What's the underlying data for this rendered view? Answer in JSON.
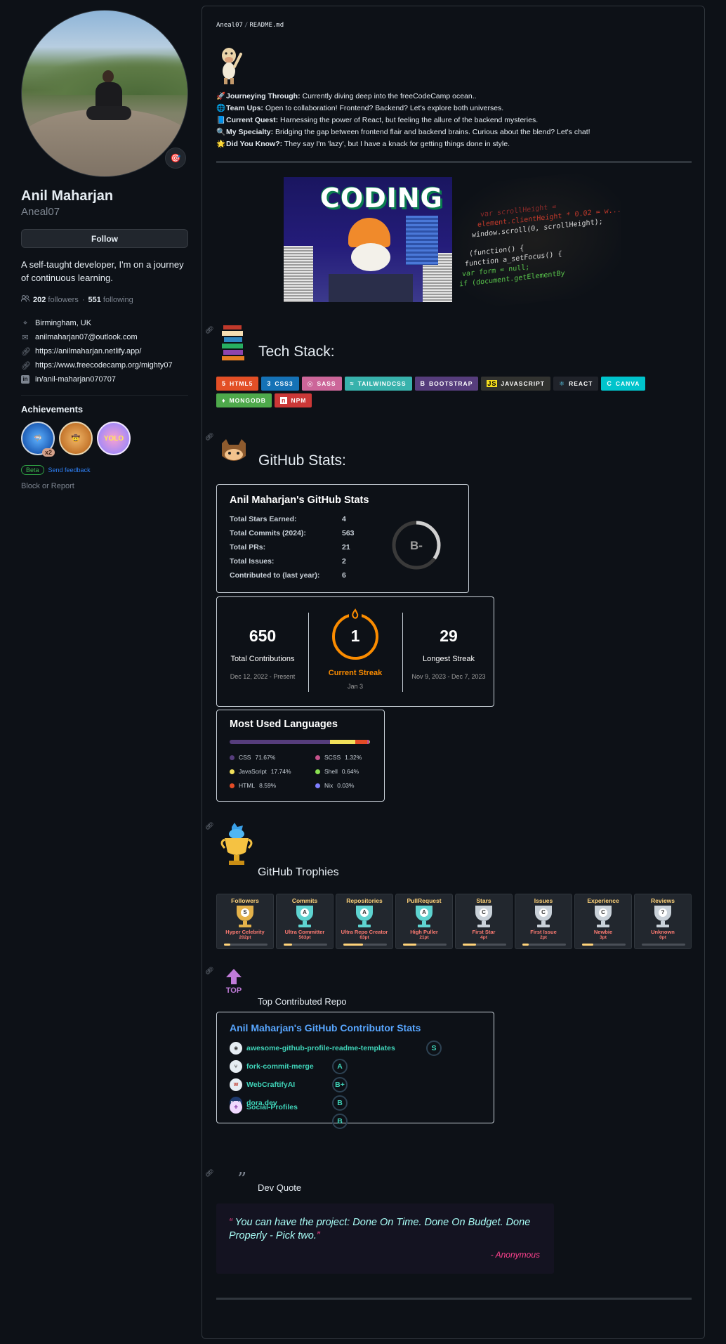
{
  "profile": {
    "full_name": "Anil Maharjan",
    "username": "Aneal07",
    "follow_label": "Follow",
    "bio": "A self-taught developer, I'm on a journey of continuous learning.",
    "followers_count": "202",
    "followers_label": "followers",
    "following_count": "551",
    "following_label": "following",
    "separator": "·",
    "location": "Birmingham, UK",
    "email": "anilmaharjan07@outlook.com",
    "website": "https://anilmaharjan.netlify.app/",
    "website2": "https://www.freecodecamp.org/mighty07",
    "linkedin": "in/anil-maharjan070707",
    "achievements_title": "Achievements",
    "badge_multiplier": "x2",
    "beta_label": "Beta",
    "send_feedback": "Send feedback",
    "block_report": "Block or Report"
  },
  "readme": {
    "repo": "Aneal07",
    "sep": "/",
    "file": "README.md",
    "intro": [
      {
        "emoji": "🚀",
        "label": "Journeying Through:",
        "text": "Currently diving deep into the freeCodeCamp ocean.."
      },
      {
        "emoji": "🌐",
        "label": "Team Ups:",
        "text": "Open to collaboration! Frontend? Backend? Let's explore both universes."
      },
      {
        "emoji": "📘",
        "label": "Current Quest:",
        "text": "Harnessing the power of React, but feeling the allure of the backend mysteries."
      },
      {
        "emoji": "🔍",
        "label": "My Specialty:",
        "text": "Bridging the gap between frontend flair and backend brains. Curious about the blend? Let's chat!"
      },
      {
        "emoji": "🌟",
        "label": "Did You Know?:",
        "text": "They say I'm 'lazy', but I have a knack for getting things done in style."
      }
    ],
    "coding_gif_text": "CODING",
    "code_lines": [
      "var scrollHeight =",
      "element.clientHeight * 0.02 = w...",
      "window.scroll(0, scrollHeight);",
      "(function() {",
      "function a_setFocus() {",
      "var form = null;",
      "if (document.getElementBy"
    ],
    "tech_stack_title": "Tech Stack:",
    "shields": [
      {
        "label": "HTML5",
        "bg": "#e34f26",
        "icon": "5"
      },
      {
        "label": "CSS3",
        "bg": "#1572b6",
        "icon": "3"
      },
      {
        "label": "SASS",
        "bg": "#cc6699",
        "icon": "◎"
      },
      {
        "label": "TAILWINDCSS",
        "bg": "#38b2ac",
        "icon": "≈"
      },
      {
        "label": "BOOTSTRAP",
        "bg": "#563d7c",
        "icon": "B"
      },
      {
        "label": "JAVASCRIPT",
        "bg": "#323330",
        "icon": "JS"
      },
      {
        "label": "REACT",
        "bg": "#20232a",
        "icon": "⚛"
      },
      {
        "label": "CANVA",
        "bg": "#00c4cc",
        "icon": "C"
      },
      {
        "label": "MONGODB",
        "bg": "#4ea94b",
        "icon": "♦"
      },
      {
        "label": "NPM",
        "bg": "#cb3837",
        "icon": "n"
      }
    ],
    "github_stats_title": "GitHub Stats:",
    "stats_card": {
      "title": "Anil Maharjan's GitHub Stats",
      "rows": [
        {
          "label": "Total Stars Earned:",
          "value": "4"
        },
        {
          "label": "Total Commits (2024):",
          "value": "563"
        },
        {
          "label": "Total PRs:",
          "value": "21"
        },
        {
          "label": "Total Issues:",
          "value": "2"
        },
        {
          "label": "Contributed to (last year):",
          "value": "6"
        }
      ],
      "grade": "B-",
      "grade_progress": 0.35
    },
    "streak": {
      "total": "650",
      "total_label": "Total Contributions",
      "total_range": "Dec 12, 2022 - Present",
      "current": "1",
      "current_label": "Current Streak",
      "current_date": "Jan 3",
      "longest": "29",
      "longest_label": "Longest Streak",
      "longest_range": "Nov 9, 2023 - Dec 7, 2023"
    },
    "languages": {
      "title": "Most Used Languages",
      "items": [
        {
          "name": "CSS",
          "pct": "71.67%",
          "value": 71.67,
          "color": "#563d7c"
        },
        {
          "name": "JavaScript",
          "pct": "17.74%",
          "value": 17.74,
          "color": "#f1e05a"
        },
        {
          "name": "HTML",
          "pct": "8.59%",
          "value": 8.59,
          "color": "#e34c26"
        },
        {
          "name": "SCSS",
          "pct": "1.32%",
          "value": 1.32,
          "color": "#c6538c"
        },
        {
          "name": "Shell",
          "pct": "0.64%",
          "value": 0.64,
          "color": "#89e051"
        },
        {
          "name": "Nix",
          "pct": "0.03%",
          "value": 0.03,
          "color": "#7e7eff"
        }
      ]
    },
    "trophies_title": "GitHub Trophies",
    "trophies": [
      {
        "title": "Followers",
        "rank": "S",
        "name": "Hyper Celebrity",
        "points": "202pt",
        "progress": 0.15,
        "color": "#e4b24a"
      },
      {
        "title": "Commits",
        "rank": "A",
        "name": "Ultra Committer",
        "points": "563pt",
        "progress": 0.2,
        "color": "#5ed3d0"
      },
      {
        "title": "Repositories",
        "rank": "A",
        "name": "Ultra Repo Creator",
        "points": "63pt",
        "progress": 0.45,
        "color": "#5ed3d0"
      },
      {
        "title": "PullRequest",
        "rank": "A",
        "name": "High Puller",
        "points": "21pt",
        "progress": 0.3,
        "color": "#5ed3d0"
      },
      {
        "title": "Stars",
        "rank": "C",
        "name": "First Star",
        "points": "4pt",
        "progress": 0.3,
        "color": "#c9d1d9"
      },
      {
        "title": "Issues",
        "rank": "C",
        "name": "First Issue",
        "points": "2pt",
        "progress": 0.15,
        "color": "#c9d1d9"
      },
      {
        "title": "Experience",
        "rank": "C",
        "name": "Newbie",
        "points": "3pt",
        "progress": 0.25,
        "color": "#c9d1d9"
      },
      {
        "title": "Reviews",
        "rank": "?",
        "name": "Unknown",
        "points": "0pt",
        "progress": 0.0,
        "color": "#c9d1d9"
      }
    ],
    "top_repo_title": "Top Contributed Repo",
    "contrib_card": {
      "title": "Anil Maharjan's GitHub Contributor Stats",
      "repos": [
        {
          "name": "awesome-github-profile-readme-templates",
          "grade": "S"
        },
        {
          "name": "fork-commit-merge",
          "grade": "A"
        },
        {
          "name": "WebCraftifyAI",
          "grade": "B+"
        },
        {
          "name": "dora.dev",
          "grade": "B"
        },
        {
          "name": "Social-Profiles",
          "grade": "B"
        }
      ]
    },
    "dev_quote_title": "Dev Quote",
    "quote": {
      "open": "“",
      "text": "You can have the project: Done On Time. Done On Budget. Done Properly - Pick two.",
      "close": "”",
      "author": "- Anonymous"
    }
  }
}
